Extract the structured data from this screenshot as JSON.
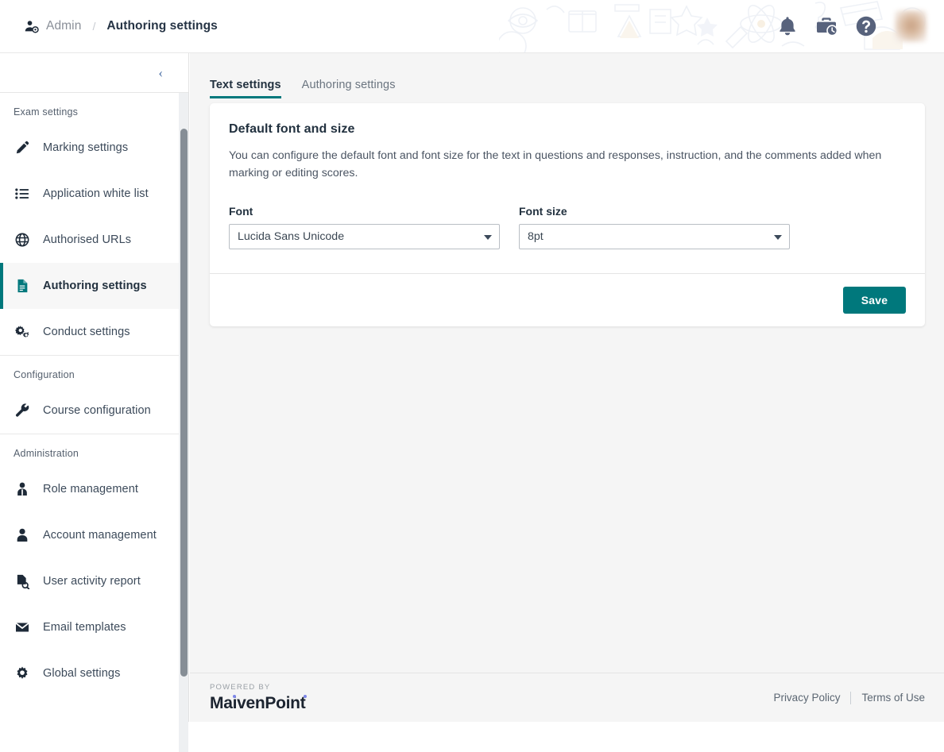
{
  "header": {
    "breadcrumb": {
      "root_icon": "user-admin-icon",
      "root_label": "Admin",
      "separator": "/",
      "current_label": "Authoring settings"
    },
    "actions": [
      {
        "name": "notifications-icon",
        "label": "Notifications"
      },
      {
        "name": "briefcase-clock-icon",
        "label": "Work history"
      },
      {
        "name": "help-icon",
        "label": "Help"
      }
    ],
    "avatar_label": "User avatar"
  },
  "sidebar": {
    "collapse_icon": "chevron-left-icon",
    "collapse_label": "‹",
    "groups": [
      {
        "title": "Exam settings",
        "items": [
          {
            "label": "Marking settings",
            "icon": "pencil-icon",
            "active": false
          },
          {
            "label": "Application white list",
            "icon": "list-icon",
            "active": false
          },
          {
            "label": "Authorised URLs",
            "icon": "globe-icon",
            "active": false
          },
          {
            "label": "Authoring settings",
            "icon": "document-icon",
            "active": true
          },
          {
            "label": "Conduct settings",
            "icon": "gears-icon",
            "active": false
          }
        ]
      },
      {
        "title": "Configuration",
        "items": [
          {
            "label": "Course configuration",
            "icon": "wrench-icon",
            "active": false
          }
        ]
      },
      {
        "title": "Administration",
        "items": [
          {
            "label": "Role management",
            "icon": "user-tie-icon",
            "active": false
          },
          {
            "label": "Account management",
            "icon": "user-icon",
            "active": false
          },
          {
            "label": "User activity report",
            "icon": "document-search-icon",
            "active": false
          },
          {
            "label": "Email templates",
            "icon": "envelope-icon",
            "active": false
          },
          {
            "label": "Global settings",
            "icon": "gear-icon",
            "active": false
          }
        ]
      }
    ]
  },
  "main": {
    "tabs": [
      {
        "label": "Text settings",
        "active": true
      },
      {
        "label": "Authoring settings",
        "active": false
      }
    ],
    "card": {
      "title": "Default font and size",
      "description": "You can configure the default font and font size for the text in questions and responses, instruction, and the comments added when marking or editing scores.",
      "fields": [
        {
          "label": "Font",
          "value": "Lucida Sans Unicode",
          "name": "font-select"
        },
        {
          "label": "Font size",
          "value": "8pt",
          "name": "font-size-select"
        }
      ],
      "save_label": "Save"
    }
  },
  "footer": {
    "powered_by": "POWERED BY",
    "brand": "MaivenPoint",
    "links": [
      {
        "label": "Privacy Policy"
      },
      {
        "label": "Terms of Use"
      }
    ]
  },
  "colors": {
    "accent": "#00787c",
    "text_dark": "#22313f",
    "text_muted": "#6b7580",
    "page_bg": "#f5f5f5",
    "brand_dot": "#7b85e8"
  }
}
